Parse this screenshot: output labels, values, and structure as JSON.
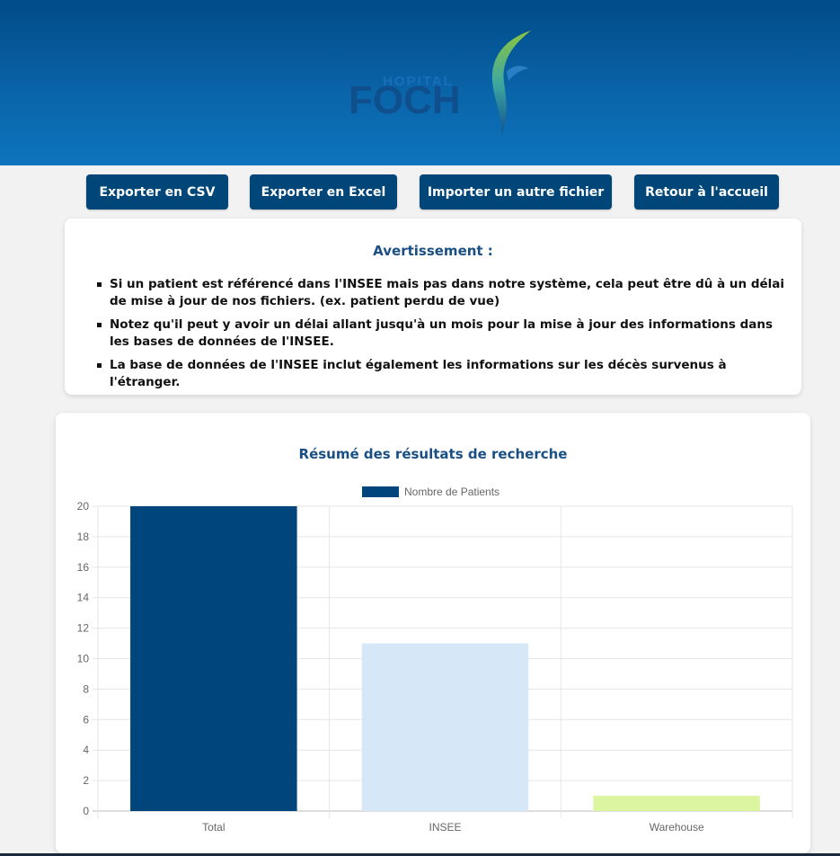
{
  "header": {
    "logo_small": "HOPITAL",
    "logo_big": "FOCH",
    "colors": {
      "background": "#0a64a8",
      "logo_blue": "#0f4f8e",
      "logo_leaf": "#8cc63f"
    }
  },
  "toolbar": {
    "export_csv": "Exporter en CSV",
    "export_excel": "Exporter en Excel",
    "import_file": "Importer un autre fichier",
    "home": "Retour à l'accueil",
    "button_color": "#004678"
  },
  "warning": {
    "title": "Avertissement :",
    "items": [
      "Si un patient est référencé dans l'INSEE mais pas dans notre système, cela peut être dû à un délai de mise à jour de nos fichiers. (ex. patient perdu de vue)",
      "Notez qu'il peut y avoir un délai allant jusqu'à un mois pour la mise à jour des informations dans les bases de données de l'INSEE.",
      "La base de données de l'INSEE inclut également les informations sur les décès survenus à l'étranger."
    ]
  },
  "summary": {
    "title": "Résumé des résultats de recherche"
  },
  "chart_data": {
    "type": "bar",
    "categories": [
      "Total",
      "INSEE",
      "Warehouse"
    ],
    "series": [
      {
        "name": "Nombre de Patients",
        "values": [
          20,
          11,
          1
        ]
      }
    ],
    "bar_colors": [
      "#00457c",
      "#d6e8f7",
      "#dcf5a0"
    ],
    "legend_color": "#00457c",
    "legend_position": "top",
    "ylim": [
      0,
      20
    ],
    "yticks": [
      0,
      2,
      4,
      6,
      8,
      10,
      12,
      14,
      16,
      18,
      20
    ],
    "grid": true
  }
}
